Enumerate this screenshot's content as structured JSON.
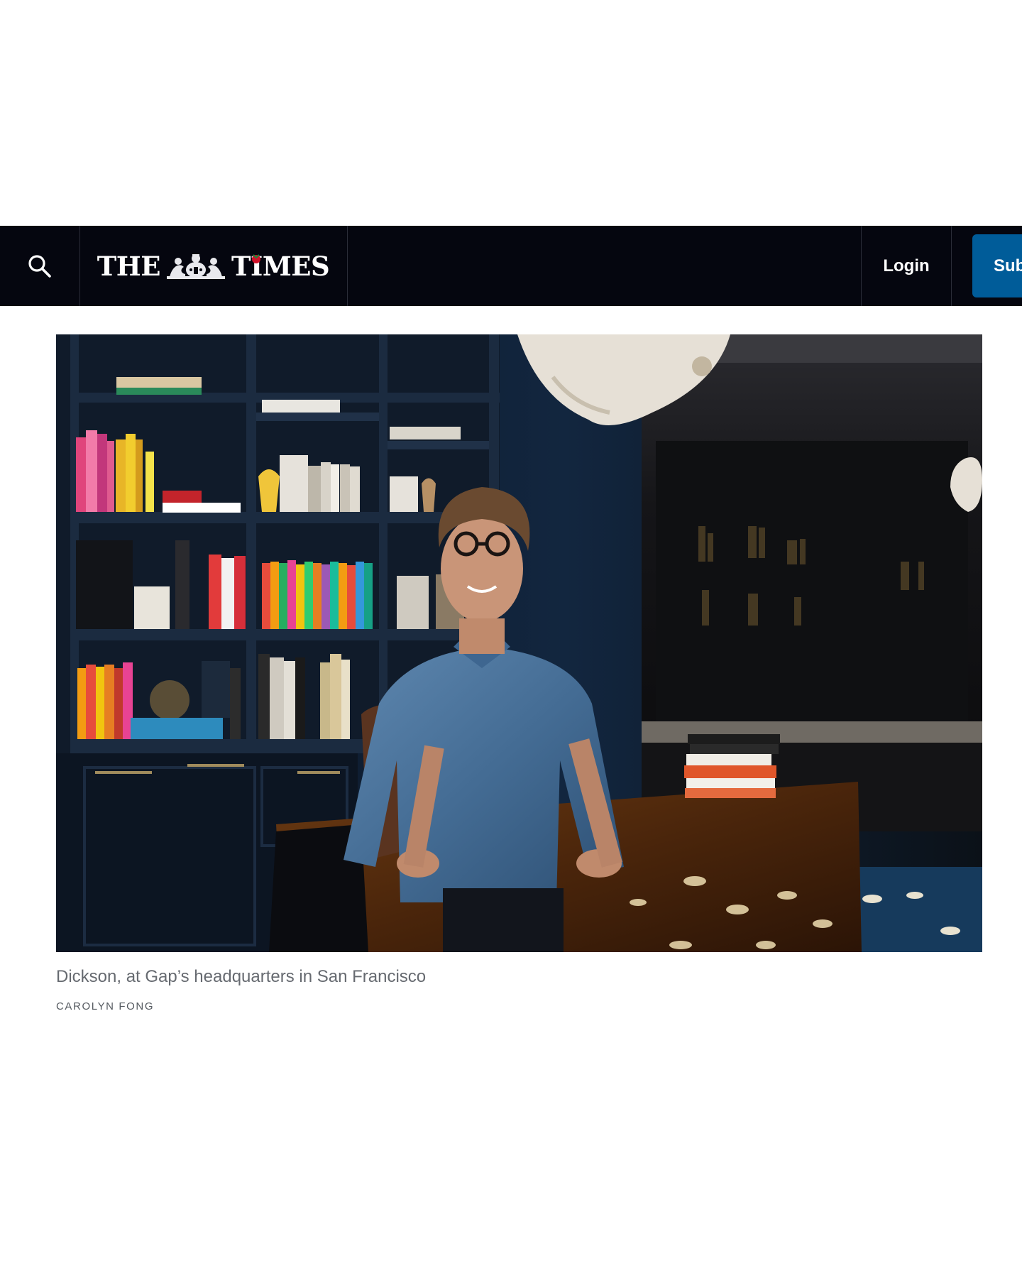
{
  "header": {
    "logo_text_left": "THE",
    "logo_text_right_a": "T",
    "logo_text_right_i": "I",
    "logo_text_right_b": "MES",
    "login_label": "Login",
    "subscribe_label": "Subscribe",
    "search_icon": "search-icon"
  },
  "article": {
    "caption": "Dickson, at Gap’s headquarters in San Francisco",
    "credit": "CAROLYN FONG"
  },
  "colors": {
    "header_bg": "#05060f",
    "subscribe_bg": "#005c99",
    "caption_text": "#666a70"
  }
}
